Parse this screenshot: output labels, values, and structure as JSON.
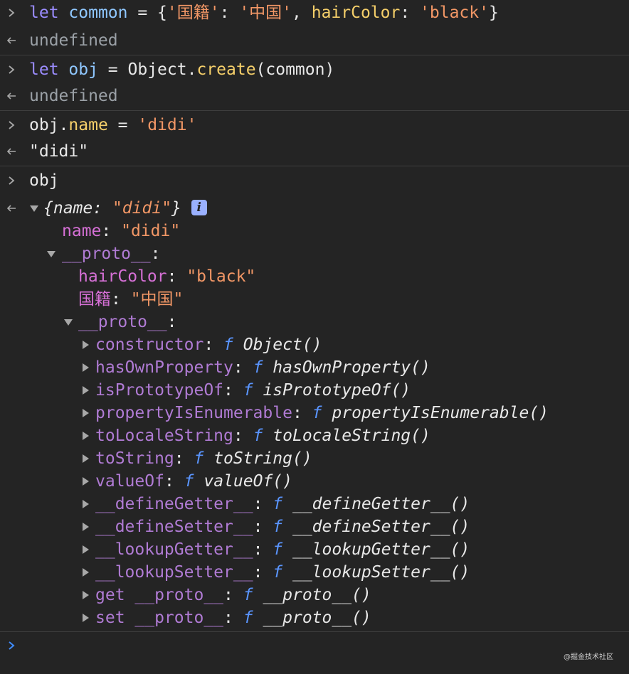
{
  "entries": [
    {
      "input": {
        "let": "let",
        "name": "common",
        "eq": " = ",
        "open": "{",
        "k1": "'国籍'",
        "colon1": ": ",
        "v1": "'中国'",
        "comma": ", ",
        "k2": "hairColor",
        "colon2": ": ",
        "v2": "'black'",
        "close": "}"
      },
      "output": "undefined"
    },
    {
      "input": {
        "let": "let",
        "name": "obj",
        "eq": " = ",
        "obj": "Object",
        "dot": ".",
        "method": "create",
        "args": "(common)"
      },
      "output": "undefined"
    },
    {
      "input": {
        "obj": "obj",
        "dot": ".",
        "prop": "name",
        "eq": " = ",
        "val": "'didi'"
      },
      "output": "\"didi\""
    },
    {
      "input": {
        "text": "obj"
      }
    }
  ],
  "tree": {
    "summary_open": "{",
    "summary_key": "name",
    "summary_colon": ": ",
    "summary_val": "\"didi\"",
    "summary_close": "}",
    "info_badge": "i",
    "name_key": "name",
    "name_val": "\"didi\"",
    "proto_label": "__proto__",
    "haircolor_key": "hairColor",
    "haircolor_val": "\"black\"",
    "nationality_key": "国籍",
    "nationality_val": "\"中国\"",
    "proto2_label": "__proto__",
    "colon": ": ",
    "f_symbol": "f",
    "object_proto_members": [
      {
        "key": "constructor",
        "value": "Object()"
      },
      {
        "key": "hasOwnProperty",
        "value": "hasOwnProperty()"
      },
      {
        "key": "isPrototypeOf",
        "value": "isPrototypeOf()"
      },
      {
        "key": "propertyIsEnumerable",
        "value": "propertyIsEnumerable()"
      },
      {
        "key": "toLocaleString",
        "value": "toLocaleString()"
      },
      {
        "key": "toString",
        "value": "toString()"
      },
      {
        "key": "valueOf",
        "value": "valueOf()"
      },
      {
        "key": "__defineGetter__",
        "value": "__defineGetter__()"
      },
      {
        "key": "__defineSetter__",
        "value": "__defineSetter__()"
      },
      {
        "key": "__lookupGetter__",
        "value": "__lookupGetter__()"
      },
      {
        "key": "__lookupSetter__",
        "value": "__lookupSetter__()"
      },
      {
        "key": "get __proto__",
        "value": "__proto__()"
      },
      {
        "key": "set __proto__",
        "value": "__proto__()"
      }
    ]
  },
  "prompt": {
    "value": ""
  },
  "watermark": "@掘金技术社区",
  "colors": {
    "background": "#242424",
    "keyword": "#9b8cff",
    "variable": "#8fc7ff",
    "method": "#f5cf6a",
    "string": "#f29766",
    "output_gray": "#9aa0a6",
    "own_key": "#d670d6",
    "inherited_key": "#b07bd4",
    "function_symbol": "#5a95ff",
    "prompt_arrow": "#3f8cff"
  },
  "icons": {
    "input_prompt": "chevron-right-icon",
    "result_marker": "return-arrow-icon",
    "expand": "triangle-down-icon",
    "collapse": "triangle-right-icon",
    "info": "info-icon"
  }
}
